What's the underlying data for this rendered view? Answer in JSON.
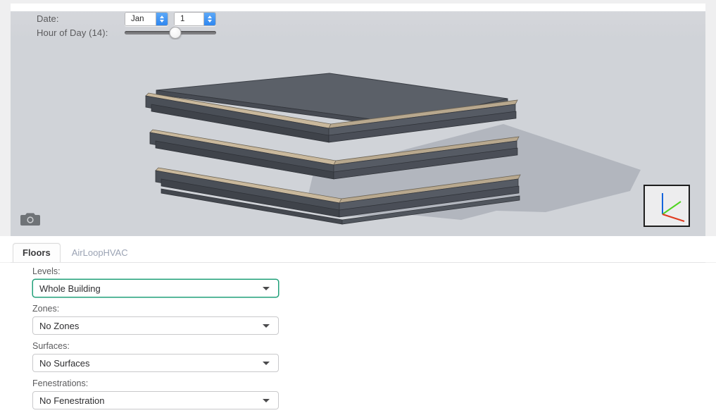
{
  "controls": {
    "date_label": "Date:",
    "month_value": "Jan",
    "day_value": "1",
    "hour_label": "Hour of Day (14):",
    "hour_value": 14,
    "slider_percent": 55,
    "month_stepper_icon": "stepper-arrows-icon",
    "day_stepper_icon": "stepper-arrows-icon"
  },
  "viewport": {
    "camera_icon": "camera-icon",
    "axis_gizmo": {
      "name": "axis-gizmo",
      "x_axis_color": "#e03a1e",
      "y_axis_color": "#4fd420",
      "z_axis_color": "#1464dc"
    },
    "background_color": "#d0d3d8",
    "shadow_color": "#b2b6be",
    "model": {
      "name": "building-floor-stack-model",
      "slab_top_color": "#5b6068",
      "slab_side_color": "#4b5059",
      "slab_edge_color": "#c9b89c",
      "floor_count": 4
    }
  },
  "tabs": [
    {
      "label": "Floors",
      "active": true
    },
    {
      "label": "AirLoopHVAC",
      "active": false
    }
  ],
  "fields": {
    "levels": {
      "label": "Levels:",
      "value": "Whole Building",
      "focused": true
    },
    "zones": {
      "label": "Zones:",
      "value": "No Zones",
      "focused": false
    },
    "surfaces": {
      "label": "Surfaces:",
      "value": "No Surfaces",
      "focused": false
    },
    "fenestrations": {
      "label": "Fenestrations:",
      "value": "No Fenestration",
      "focused": false
    }
  },
  "colors": {
    "accent_focus": "#22a07a",
    "stepper_blue": "#2f87f0",
    "panel_gray": "#d0d3d8",
    "label_text": "#5b5b5d",
    "tab_inactive": "#9ba3b4"
  }
}
